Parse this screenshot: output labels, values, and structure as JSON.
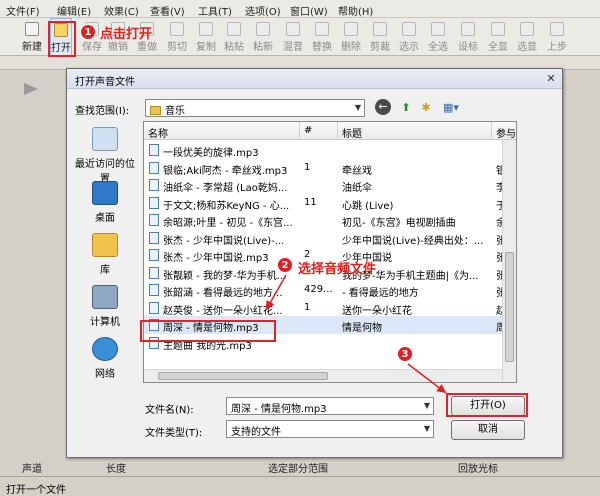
{
  "menu": [
    "文件(F)",
    "编辑(E)",
    "效果(C)",
    "查看(V)",
    "工具(T)",
    "选项(O)",
    "窗口(W)",
    "帮助(H)"
  ],
  "toolbar": [
    {
      "label": "新建",
      "name": "new"
    },
    {
      "label": "打开",
      "name": "open"
    },
    {
      "label": "保存",
      "name": "save"
    },
    {
      "label": "撤销",
      "name": "undo"
    },
    {
      "label": "重做",
      "name": "redo"
    },
    {
      "label": "剪切",
      "name": "cut"
    },
    {
      "label": "复制",
      "name": "copy"
    },
    {
      "label": "粘贴",
      "name": "paste"
    },
    {
      "label": "粘新",
      "name": "paste-new"
    },
    {
      "label": "混音",
      "name": "mix"
    },
    {
      "label": "替换",
      "name": "replace"
    },
    {
      "label": "删除",
      "name": "delete"
    },
    {
      "label": "剪裁",
      "name": "trim"
    },
    {
      "label": "选示",
      "name": "select-show"
    },
    {
      "label": "全选",
      "name": "select-all"
    },
    {
      "label": "设标",
      "name": "set-marker"
    },
    {
      "label": "全显",
      "name": "show-all"
    },
    {
      "label": "选显",
      "name": "show-selection"
    },
    {
      "label": "上步",
      "name": "step-up"
    }
  ],
  "annotations": {
    "step1_num": "1",
    "step1_text": "点击打开",
    "step2_num": "2",
    "step2_text": "选择音频文件",
    "step3_num": "3"
  },
  "dialog": {
    "title": "打开声音文件",
    "close": "✕",
    "look_in_label": "查找范围(I):",
    "look_in_value": "音乐",
    "places": [
      "最近访问的位置",
      "桌面",
      "库",
      "计算机",
      "网络"
    ],
    "columns": [
      "名称",
      "#",
      "标题",
      "参与"
    ],
    "files": [
      {
        "name": "一段优美的旋律.mp3",
        "num": "",
        "title": "",
        "artist": ""
      },
      {
        "name": "银临;Aki阿杰 - 牵丝戏.mp3",
        "num": "1",
        "title": "牵丝戏",
        "artist": "银临"
      },
      {
        "name": "油纸伞 - 李常超 (Lao乾妈...",
        "num": "",
        "title": "油纸伞",
        "artist": "李常"
      },
      {
        "name": "于文文;杨和苏KeyNG - 心...",
        "num": "11",
        "title": "心跳 (Live)",
        "artist": "于文"
      },
      {
        "name": "余昭源;叶里 - 初见 -《东宫...",
        "num": "",
        "title": "初见-《东宫》电视剧插曲",
        "artist": "余昭"
      },
      {
        "name": "张杰 - 少年中国说(Live)-...",
        "num": "",
        "title": "少年中国说(Live)-经典出处：...",
        "artist": "张杰"
      },
      {
        "name": "张杰 - 少年中国说.mp3",
        "num": "2",
        "title": "少年中国说",
        "artist": "张杰"
      },
      {
        "name": "张靓颖 - 我的梦-华为手机...",
        "num": "",
        "title": "我的梦-华为手机主题曲|《为...",
        "artist": "张靓"
      },
      {
        "name": "张韶涵 - 看得最远的地方...",
        "num": "429...",
        "title": "- 看得最远的地方",
        "artist": "张韶"
      },
      {
        "name": "赵英俊 - 送你一朵小红花...",
        "num": "1",
        "title": "送你一朵小红花",
        "artist": "赵英"
      },
      {
        "name": "周深 - 情是何物.mp3",
        "num": "",
        "title": "情是何物",
        "artist": "周深"
      },
      {
        "name": "主题曲 我的光.mp3",
        "num": "",
        "title": "",
        "artist": ""
      }
    ],
    "selected_index": 10,
    "filename_label": "文件名(N):",
    "filename_value": "周深 - 情是何物.mp3",
    "filetype_label": "文件类型(T):",
    "filetype_value": "支持的文件",
    "open_button": "打开(O)",
    "cancel_button": "取消"
  },
  "bottom_headers": [
    "声道",
    "长度",
    "选定部分范围",
    "回放光标"
  ],
  "status": "打开一个文件",
  "colors": {
    "callout": "#e02020",
    "selection": "#dce8f7",
    "accent": "#3a7bd5"
  }
}
